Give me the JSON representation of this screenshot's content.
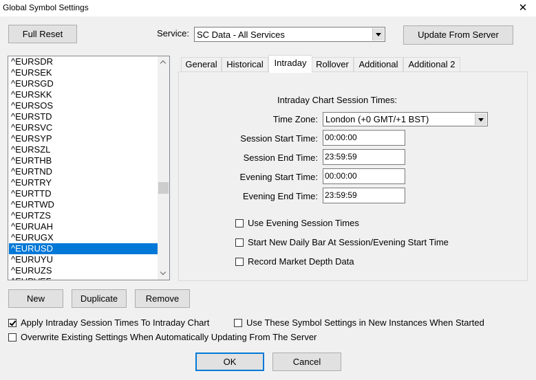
{
  "window": {
    "title": "Global Symbol Settings",
    "close_glyph": "✕"
  },
  "toolbar": {
    "full_reset": "Full Reset",
    "service_label": "Service:",
    "service_value": "SC Data - All Services",
    "update_from_server": "Update From Server"
  },
  "symbol_list": {
    "items": [
      "^EURSDR",
      "^EURSEK",
      "^EURSGD",
      "^EURSKK",
      "^EURSOS",
      "^EURSTD",
      "^EURSVC",
      "^EURSYP",
      "^EURSZL",
      "^EURTHB",
      "^EURTND",
      "^EURTRY",
      "^EURTTD",
      "^EURTWD",
      "^EURTZS",
      "^EURUAH",
      "^EURUGX",
      "^EURUSD",
      "^EURUYU",
      "^EURUZS",
      "^EURVEF"
    ],
    "selected": "^EURUSD"
  },
  "tabs": [
    "General",
    "Historical",
    "Intraday",
    "Rollover",
    "Additional",
    "Additional 2"
  ],
  "active_tab": "Intraday",
  "intraday": {
    "heading": "Intraday Chart Session Times:",
    "time_zone_label": "Time Zone:",
    "time_zone_value": "London (+0 GMT/+1 BST)",
    "session_start_label": "Session Start Time:",
    "session_start_value": "00:00:00",
    "session_end_label": "Session End Time:",
    "session_end_value": "23:59:59",
    "evening_start_label": "Evening Start Time:",
    "evening_start_value": "00:00:00",
    "evening_end_label": "Evening End Time:",
    "evening_end_value": "23:59:59",
    "use_evening_label": "Use Evening Session Times",
    "use_evening_checked": false,
    "start_new_bar_label": "Start New Daily Bar At Session/Evening Start Time",
    "start_new_bar_checked": false,
    "record_depth_label": "Record Market Depth Data",
    "record_depth_checked": false
  },
  "list_buttons": {
    "new": "New",
    "duplicate": "Duplicate",
    "remove": "Remove"
  },
  "options": {
    "apply_intraday_label": "Apply Intraday Session Times To Intraday Chart",
    "apply_intraday_checked": true,
    "use_in_new_label": "Use These Symbol Settings in New Instances When Started",
    "use_in_new_checked": false,
    "overwrite_label": "Overwrite Existing Settings When Automatically Updating From The Server",
    "overwrite_checked": false
  },
  "footer": {
    "ok": "OK",
    "cancel": "Cancel"
  },
  "colors": {
    "selection": "#0078d7",
    "dialog_bg": "#f0f0f0",
    "button_bg": "#e1e1e1"
  }
}
